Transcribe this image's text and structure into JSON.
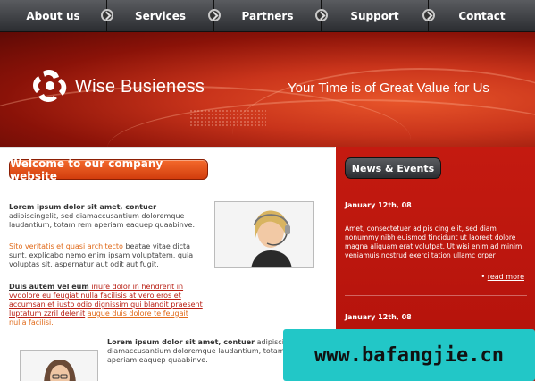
{
  "nav": {
    "items": [
      {
        "label": "About us"
      },
      {
        "label": "Services"
      },
      {
        "label": "Partners"
      },
      {
        "label": "Support"
      },
      {
        "label": "Contact"
      }
    ]
  },
  "header": {
    "logo_text": "Wise Busieness",
    "tagline": "Your Time is of Great Value for Us"
  },
  "main": {
    "welcome_label": "Welcome to our company website",
    "p1_bold": "Lorem ipsum dolor sit amet, contuer",
    "p1_rest": " adipiscingelit, sed diamaccusantium doloremque laudantium, totam rem aperiam eaquep quaabinve.",
    "p2_link": "Sito veritatis et quasi architecto",
    "p2_rest": " beatae vitae dicta sunt, explicabo nemo enim ipsam voluptatem, quia voluptas sit, aspernatur aut odit aut fugit.",
    "p3_bold": "Duis autem vel eum",
    "p3_red": " iriure dolor in hendrerit in vvdolore eu feugiat nulla facilisis at vero eros et accumsan et iusto odio dignissim qui blandit praesent luptatum zzril delenit",
    "p3_orange": "augue duis dolore te feugait nulla facilisi.",
    "p4_bold": "Lorem ipsum dolor sit amet, contuer",
    "p4_rest": " adipiscingelit, sed diamaccusantium doloremque laudantium, totam rem aperiam eaquep quaabinve."
  },
  "news": {
    "title": "News & Events",
    "items": [
      {
        "date": "January 12th, 08",
        "text_a": "Amet, consectetuer adipis cing elit, sed diam nonummy nibh euismod tincidunt ",
        "text_link": "ut laoreet dolore",
        "text_b": " magna aliquam erat volutpat. Ut wisi enim ad minim veniamuis nostrud exerci tation ullamc orper",
        "more": "read more"
      },
      {
        "date": "January 12th, 08"
      }
    ]
  },
  "watermark": "www.bafangjie.cn"
}
